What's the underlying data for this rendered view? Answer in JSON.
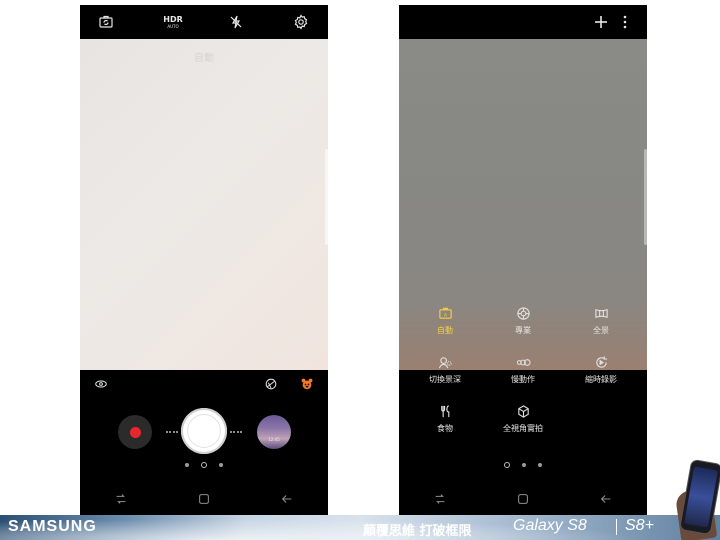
{
  "left_screen": {
    "topbar": {
      "hdr_label": "HDR",
      "hdr_sub": "AUTO",
      "icons": [
        "switch-camera-icon",
        "hdr-auto-icon",
        "flash-off-icon",
        "settings-icon"
      ]
    },
    "viewfinder_label": "自動",
    "quick_icons": [
      "bixby-vision-icon",
      "filter-icon",
      "sticker-icon"
    ],
    "gallery_caption": "12:45",
    "page_dots": 3,
    "nav": [
      "recent-apps-icon",
      "home-icon",
      "back-icon"
    ]
  },
  "right_screen": {
    "topbar": {
      "icons": [
        "plus-icon",
        "more-vert-icon"
      ]
    },
    "modes": [
      {
        "label": "自動",
        "icon": "auto-mode-icon",
        "active": true
      },
      {
        "label": "專業",
        "icon": "pro-mode-icon",
        "active": false
      },
      {
        "label": "全景",
        "icon": "panorama-icon",
        "active": false
      },
      {
        "label": "切換景深",
        "icon": "selective-focus-icon",
        "active": false
      },
      {
        "label": "慢動作",
        "icon": "slow-motion-icon",
        "active": false
      },
      {
        "label": "縮時錄影",
        "icon": "hyperlapse-icon",
        "active": false
      },
      {
        "label": "食物",
        "icon": "food-icon",
        "active": false
      },
      {
        "label": "全視角實拍",
        "icon": "virtual-shot-icon",
        "active": false
      }
    ],
    "page_dots": 3,
    "nav": [
      "recent-apps-icon",
      "home-icon",
      "back-icon"
    ]
  },
  "banner": {
    "brand": "SAMSUNG",
    "tagline": "顛覆思維 打破框限",
    "model1": "Galaxy S8",
    "model2": "S8+"
  },
  "colors": {
    "active_mode": "#f5d23c",
    "record": "#e8262e"
  }
}
